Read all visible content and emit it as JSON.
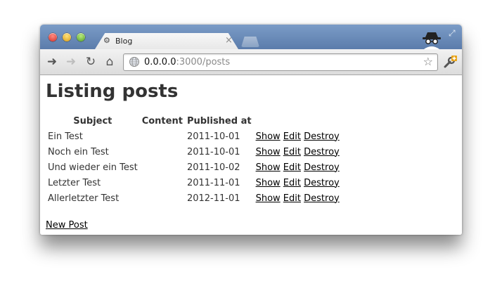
{
  "browser": {
    "tab_title": "Blog",
    "url_host": "0.0.0.0",
    "url_rest": ":3000/posts"
  },
  "page": {
    "heading": "Listing posts",
    "columns": [
      "Subject",
      "Content",
      "Published at"
    ],
    "rows": [
      {
        "subject": "Ein Test",
        "content": "",
        "published_at": "2011-10-01"
      },
      {
        "subject": "Noch ein Test",
        "content": "",
        "published_at": "2011-10-01"
      },
      {
        "subject": "Und wieder ein Test",
        "content": "",
        "published_at": "2011-10-02"
      },
      {
        "subject": "Letzter Test",
        "content": "",
        "published_at": "2011-11-01"
      },
      {
        "subject": "Allerletzter Test",
        "content": "",
        "published_at": "2012-11-01"
      }
    ],
    "actions": {
      "show": "Show",
      "edit": "Edit",
      "destroy": "Destroy"
    },
    "new_post_label": "New Post"
  }
}
